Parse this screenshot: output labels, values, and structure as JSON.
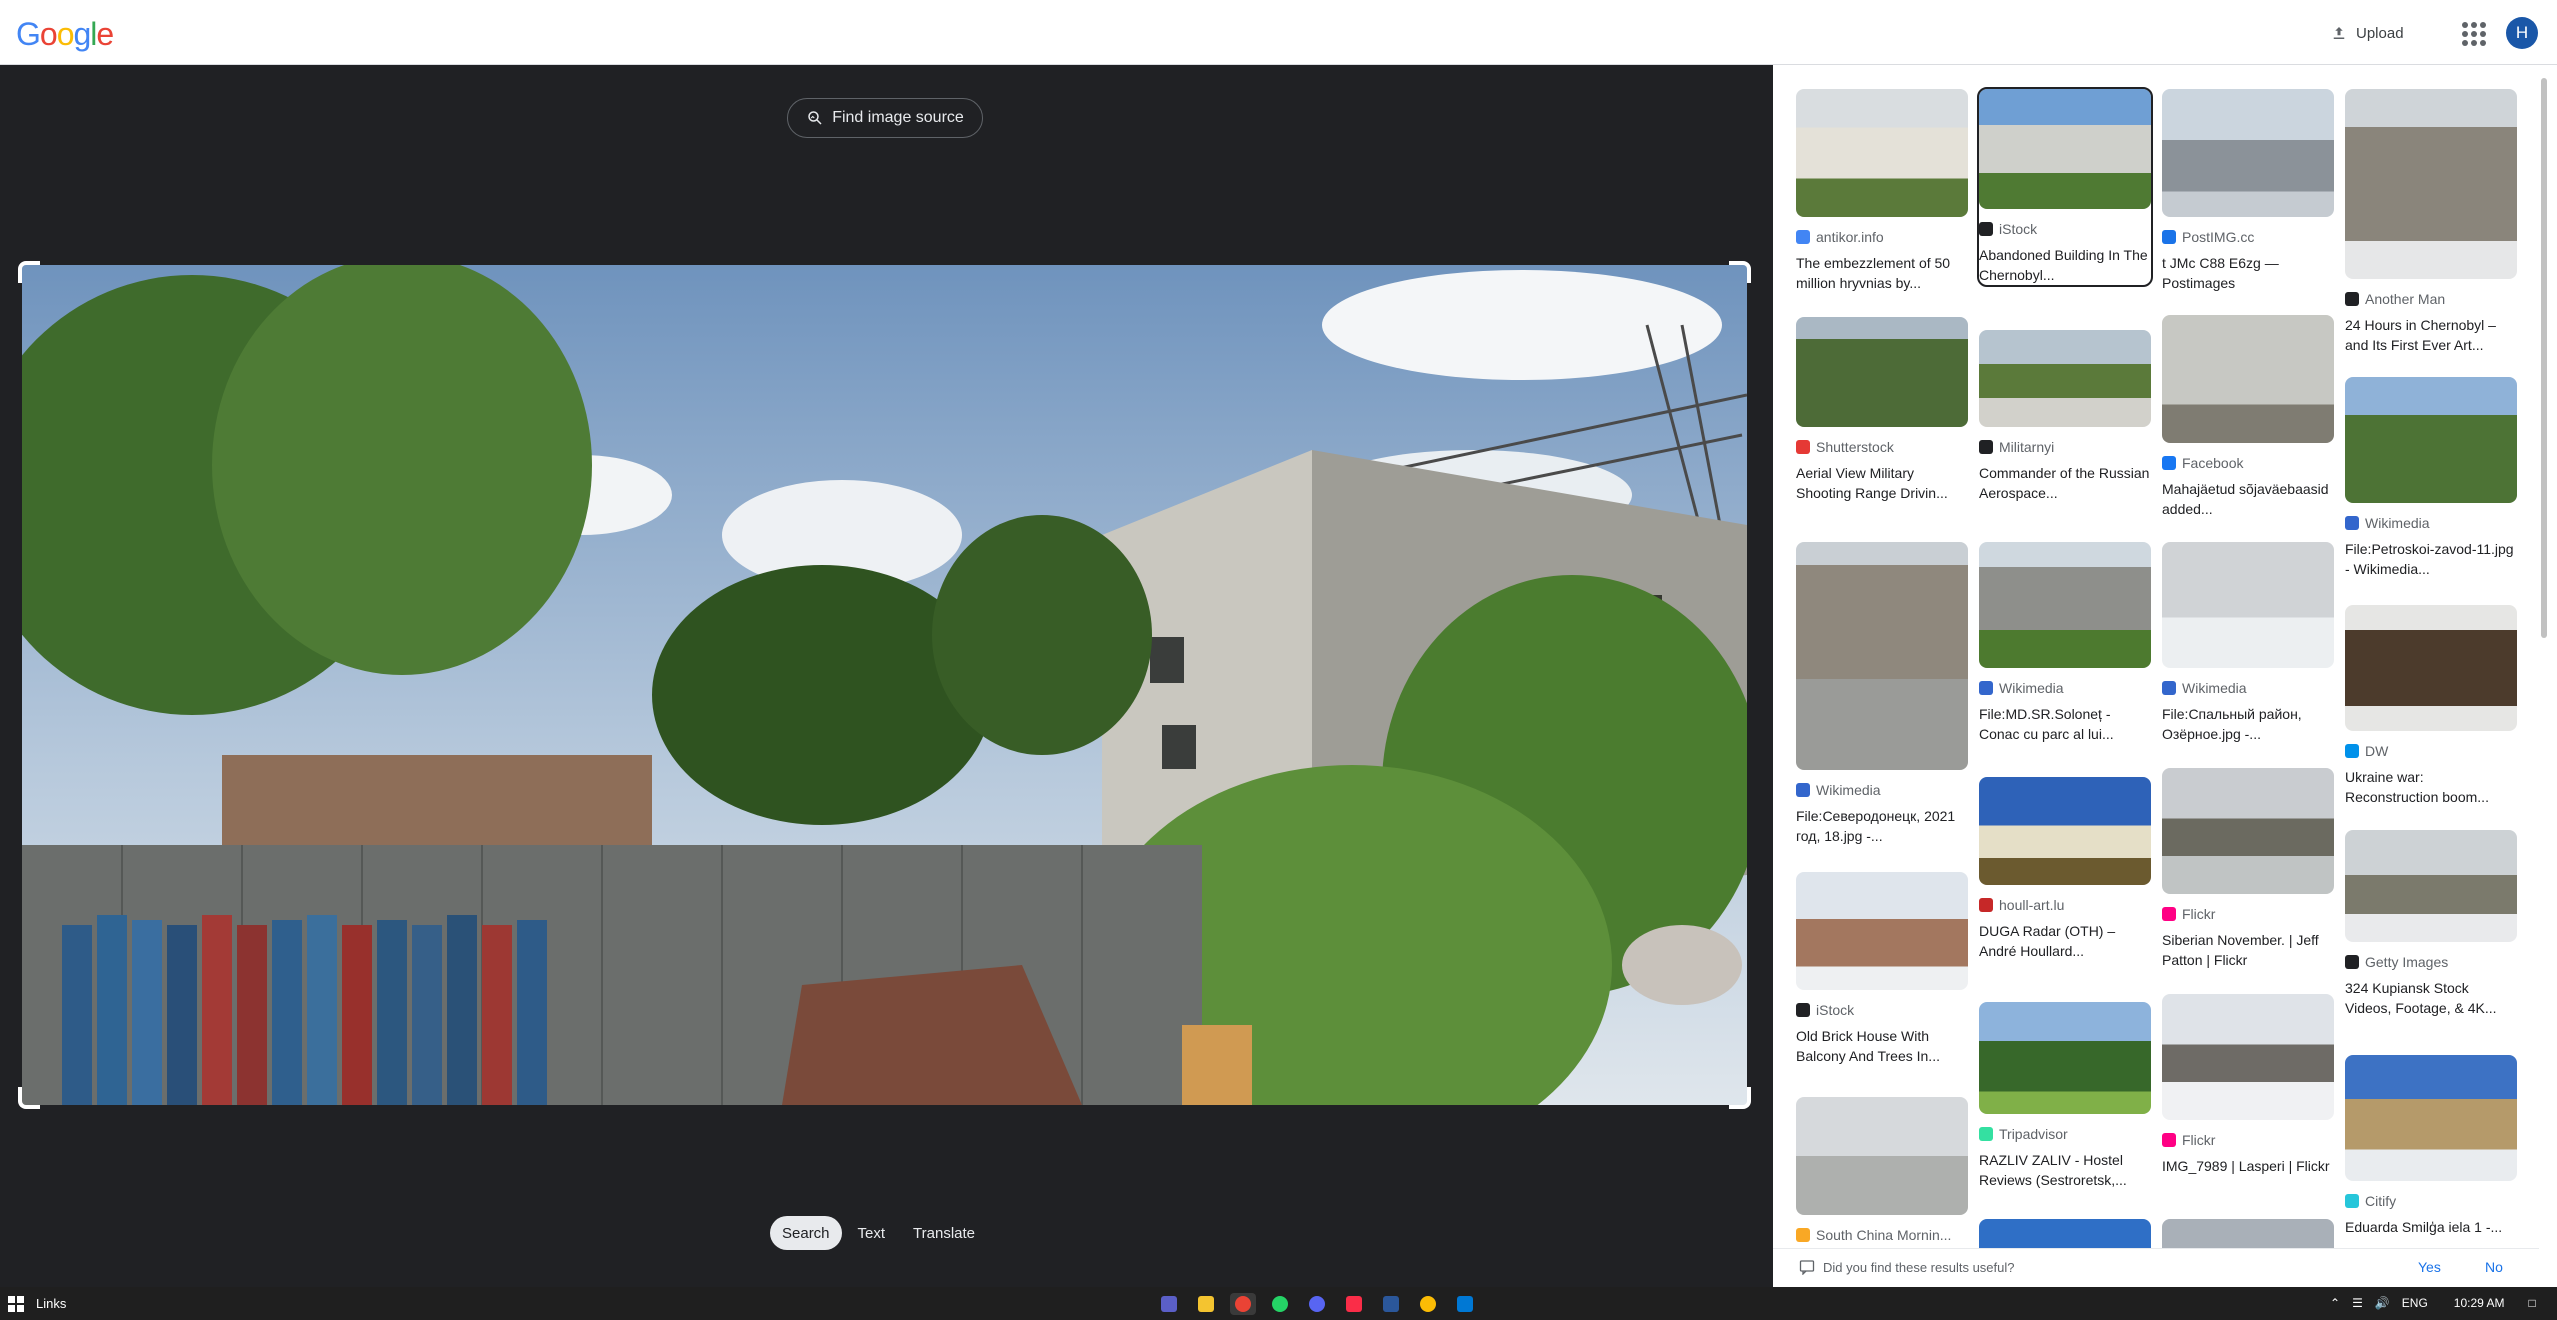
{
  "header": {
    "logo_letters": [
      "G",
      "o",
      "o",
      "g",
      "l",
      "e"
    ],
    "logo_colors": [
      "#4285f4",
      "#ea4335",
      "#fbbc05",
      "#4285f4",
      "#34a853",
      "#ea4335"
    ],
    "upload_label": "Upload",
    "avatar_letter": "H"
  },
  "left": {
    "find_source_label": "Find image source",
    "tabs": [
      {
        "label": "Search",
        "active": true
      },
      {
        "label": "Text",
        "active": false
      },
      {
        "label": "Translate",
        "active": false
      }
    ]
  },
  "results": [
    {
      "source": "antikor.info",
      "title": "The embezzlement of 50 million hryvnias by...",
      "fav_color": "#4285f4"
    },
    {
      "source": "iStock",
      "title": "Abandoned Building In The Chernobyl...",
      "fav_color": "#202124"
    },
    {
      "source": "PostIMG.cc",
      "title": "t JMc C88 E6zg — Postimages",
      "fav_color": "#1a73e8"
    },
    {
      "source": "Another Man",
      "title": "24 Hours in Chernobyl – and Its First Ever Art...",
      "fav_color": "#202124"
    },
    {
      "source": "Shutterstock",
      "title": "Aerial View Military Shooting Range Drivin...",
      "fav_color": "#e53935"
    },
    {
      "source": "Militarnyi",
      "title": "Commander of the Russian Aerospace...",
      "fav_color": "#202124"
    },
    {
      "source": "Facebook",
      "title": "Mahajäetud sõjaväebaasid added...",
      "fav_color": "#1877f2"
    },
    {
      "source": "Wikimedia",
      "title": "File:Petroskoi-zavod-11.jpg - Wikimedia...",
      "fav_color": "#3366cc"
    },
    {
      "source": "Wikimedia",
      "title": "File:Северодонецк, 2021 год, 18.jpg -...",
      "fav_color": "#3366cc"
    },
    {
      "source": "Wikimedia",
      "title": "File:MD.SR.Soloneț - Conac cu parc al lui...",
      "fav_color": "#3366cc"
    },
    {
      "source": "Wikimedia",
      "title": "File:Спальный район, Озёрное.jpg -...",
      "fav_color": "#3366cc"
    },
    {
      "source": "DW",
      "title": "Ukraine war: Reconstruction boom...",
      "fav_color": "#0091ea"
    },
    {
      "source": "houll-art.lu",
      "title": "DUGA Radar (OTH) – André Houllard...",
      "fav_color": "#c62828"
    },
    {
      "source": "Flickr",
      "title": "Siberian November. | Jeff Patton | Flickr",
      "fav_color": "#ff0084"
    },
    {
      "source": "Getty Images",
      "title": "324 Kupiansk Stock Videos, Footage, & 4K...",
      "fav_color": "#202124"
    },
    {
      "source": "iStock",
      "title": "Old Brick House With Balcony And Trees In...",
      "fav_color": "#202124"
    },
    {
      "source": "Tripadvisor",
      "title": "RAZLIV ZALIV - Hostel Reviews (Sestroretsk,...",
      "fav_color": "#34e0a1"
    },
    {
      "source": "Flickr",
      "title": "IMG_7989 | Lasperi | Flickr",
      "fav_color": "#ff0084"
    },
    {
      "source": "Citify",
      "title": "Eduarda Smilģa iela 1 -...",
      "fav_color": "#26c6da"
    },
    {
      "source": "South China Mornin...",
      "title": "",
      "fav_color": "#f9a825"
    }
  ],
  "feedback": {
    "question": "Did you find these results useful?",
    "yes_label": "Yes",
    "no_label": "No"
  },
  "taskbar": {
    "links_label": "Links",
    "language": "ENG",
    "time": "10:29 AM"
  }
}
